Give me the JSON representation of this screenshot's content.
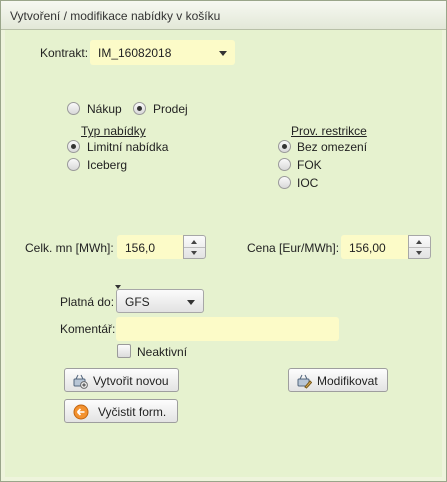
{
  "window": {
    "title": "Vytvoření / modifikace nabídky v košíku"
  },
  "contract": {
    "label": "Kontrakt:",
    "value": "IM_16082018"
  },
  "trade_type": {
    "options": [
      "Nákup",
      "Prodej"
    ],
    "selected": "Prodej"
  },
  "offer_type": {
    "heading": "Typ nabídky",
    "options": [
      "Limitní nabídka",
      "Iceberg"
    ],
    "selected": "Limitní nabídka"
  },
  "restriction": {
    "heading": "Prov. restrikce",
    "options": [
      "Bez omezení",
      "FOK",
      "IOC"
    ],
    "selected": "Bez omezení"
  },
  "quantity": {
    "label": "Celk. mn [MWh]:",
    "value": "156,0"
  },
  "price": {
    "label": "Cena [Eur/MWh]:",
    "value": "156,00"
  },
  "valid_until": {
    "label": "Platná do:",
    "value": "GFS"
  },
  "comment": {
    "label": "Komentář:",
    "value": ""
  },
  "inactive": {
    "label": "Neaktivní",
    "checked": false
  },
  "buttons": {
    "create_new": "Vytvořit novou",
    "modify": "Modifikovat",
    "clear_form": "Vyčistit form."
  },
  "colors": {
    "background": "#e6f2cf",
    "field": "#fcfbc8",
    "title_bar": "#eef0e8"
  }
}
